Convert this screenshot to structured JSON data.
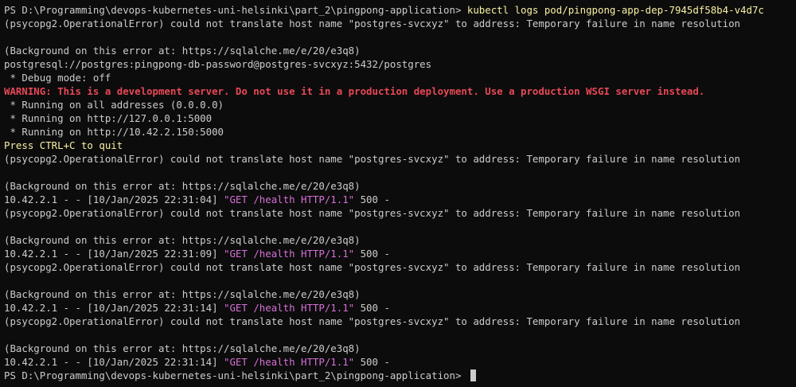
{
  "theme": {
    "background": "#0c0c0c",
    "default": "#cccccc",
    "command": "#f9f1a5",
    "warning": "#e74856",
    "yellow": "#f9f1a5",
    "request": "#d670d6"
  },
  "lines": [
    [
      {
        "t": "PS D:\\Programming\\devops-kubernetes-uni-helsinki\\part_2\\pingpong-application> ",
        "c": "default"
      },
      {
        "t": "kubectl logs pod/pingpong-app-dep-7945df58b4-v4d7c",
        "c": "command"
      }
    ],
    [
      {
        "t": "(psycopg2.OperationalError) could not translate host name \"postgres-svcxyz\" to address: Temporary failure in name resolution",
        "c": "default"
      }
    ],
    [],
    [
      {
        "t": "(Background on this error at: https://sqlalche.me/e/20/e3q8)",
        "c": "default"
      }
    ],
    [
      {
        "t": "postgresql://postgres:pingpong-db-password@postgres-svcxyz:5432/postgres",
        "c": "default"
      }
    ],
    [
      {
        "t": " * Debug mode: off",
        "c": "default"
      }
    ],
    [
      {
        "t": "WARNING: This is a development server. Do not use it in a production deployment. Use a production WSGI server instead.",
        "c": "warning"
      }
    ],
    [
      {
        "t": " * Running on all addresses (0.0.0.0)",
        "c": "default"
      }
    ],
    [
      {
        "t": " * Running on http://127.0.0.1:5000",
        "c": "default"
      }
    ],
    [
      {
        "t": " * Running on http://10.42.2.150:5000",
        "c": "default"
      }
    ],
    [
      {
        "t": "Press CTRL+C to quit",
        "c": "yellow"
      }
    ],
    [
      {
        "t": "(psycopg2.OperationalError) could not translate host name \"postgres-svcxyz\" to address: Temporary failure in name resolution",
        "c": "default"
      }
    ],
    [],
    [
      {
        "t": "(Background on this error at: https://sqlalche.me/e/20/e3q8)",
        "c": "default"
      }
    ],
    [
      {
        "t": "10.42.2.1 - - [10/Jan/2025 22:31:04] ",
        "c": "default"
      },
      {
        "t": "\"GET /health HTTP/1.1\"",
        "c": "request"
      },
      {
        "t": " 500 -",
        "c": "default"
      }
    ],
    [
      {
        "t": "(psycopg2.OperationalError) could not translate host name \"postgres-svcxyz\" to address: Temporary failure in name resolution",
        "c": "default"
      }
    ],
    [],
    [
      {
        "t": "(Background on this error at: https://sqlalche.me/e/20/e3q8)",
        "c": "default"
      }
    ],
    [
      {
        "t": "10.42.2.1 - - [10/Jan/2025 22:31:09] ",
        "c": "default"
      },
      {
        "t": "\"GET /health HTTP/1.1\"",
        "c": "request"
      },
      {
        "t": " 500 -",
        "c": "default"
      }
    ],
    [
      {
        "t": "(psycopg2.OperationalError) could not translate host name \"postgres-svcxyz\" to address: Temporary failure in name resolution",
        "c": "default"
      }
    ],
    [],
    [
      {
        "t": "(Background on this error at: https://sqlalche.me/e/20/e3q8)",
        "c": "default"
      }
    ],
    [
      {
        "t": "10.42.2.1 - - [10/Jan/2025 22:31:14] ",
        "c": "default"
      },
      {
        "t": "\"GET /health HTTP/1.1\"",
        "c": "request"
      },
      {
        "t": " 500 -",
        "c": "default"
      }
    ],
    [
      {
        "t": "(psycopg2.OperationalError) could not translate host name \"postgres-svcxyz\" to address: Temporary failure in name resolution",
        "c": "default"
      }
    ],
    [],
    [
      {
        "t": "(Background on this error at: https://sqlalche.me/e/20/e3q8)",
        "c": "default"
      }
    ],
    [
      {
        "t": "10.42.2.1 - - [10/Jan/2025 22:31:14] ",
        "c": "default"
      },
      {
        "t": "\"GET /health HTTP/1.1\"",
        "c": "request"
      },
      {
        "t": " 500 -",
        "c": "default"
      }
    ]
  ],
  "prompt": "PS D:\\Programming\\devops-kubernetes-uni-helsinki\\part_2\\pingpong-application> "
}
